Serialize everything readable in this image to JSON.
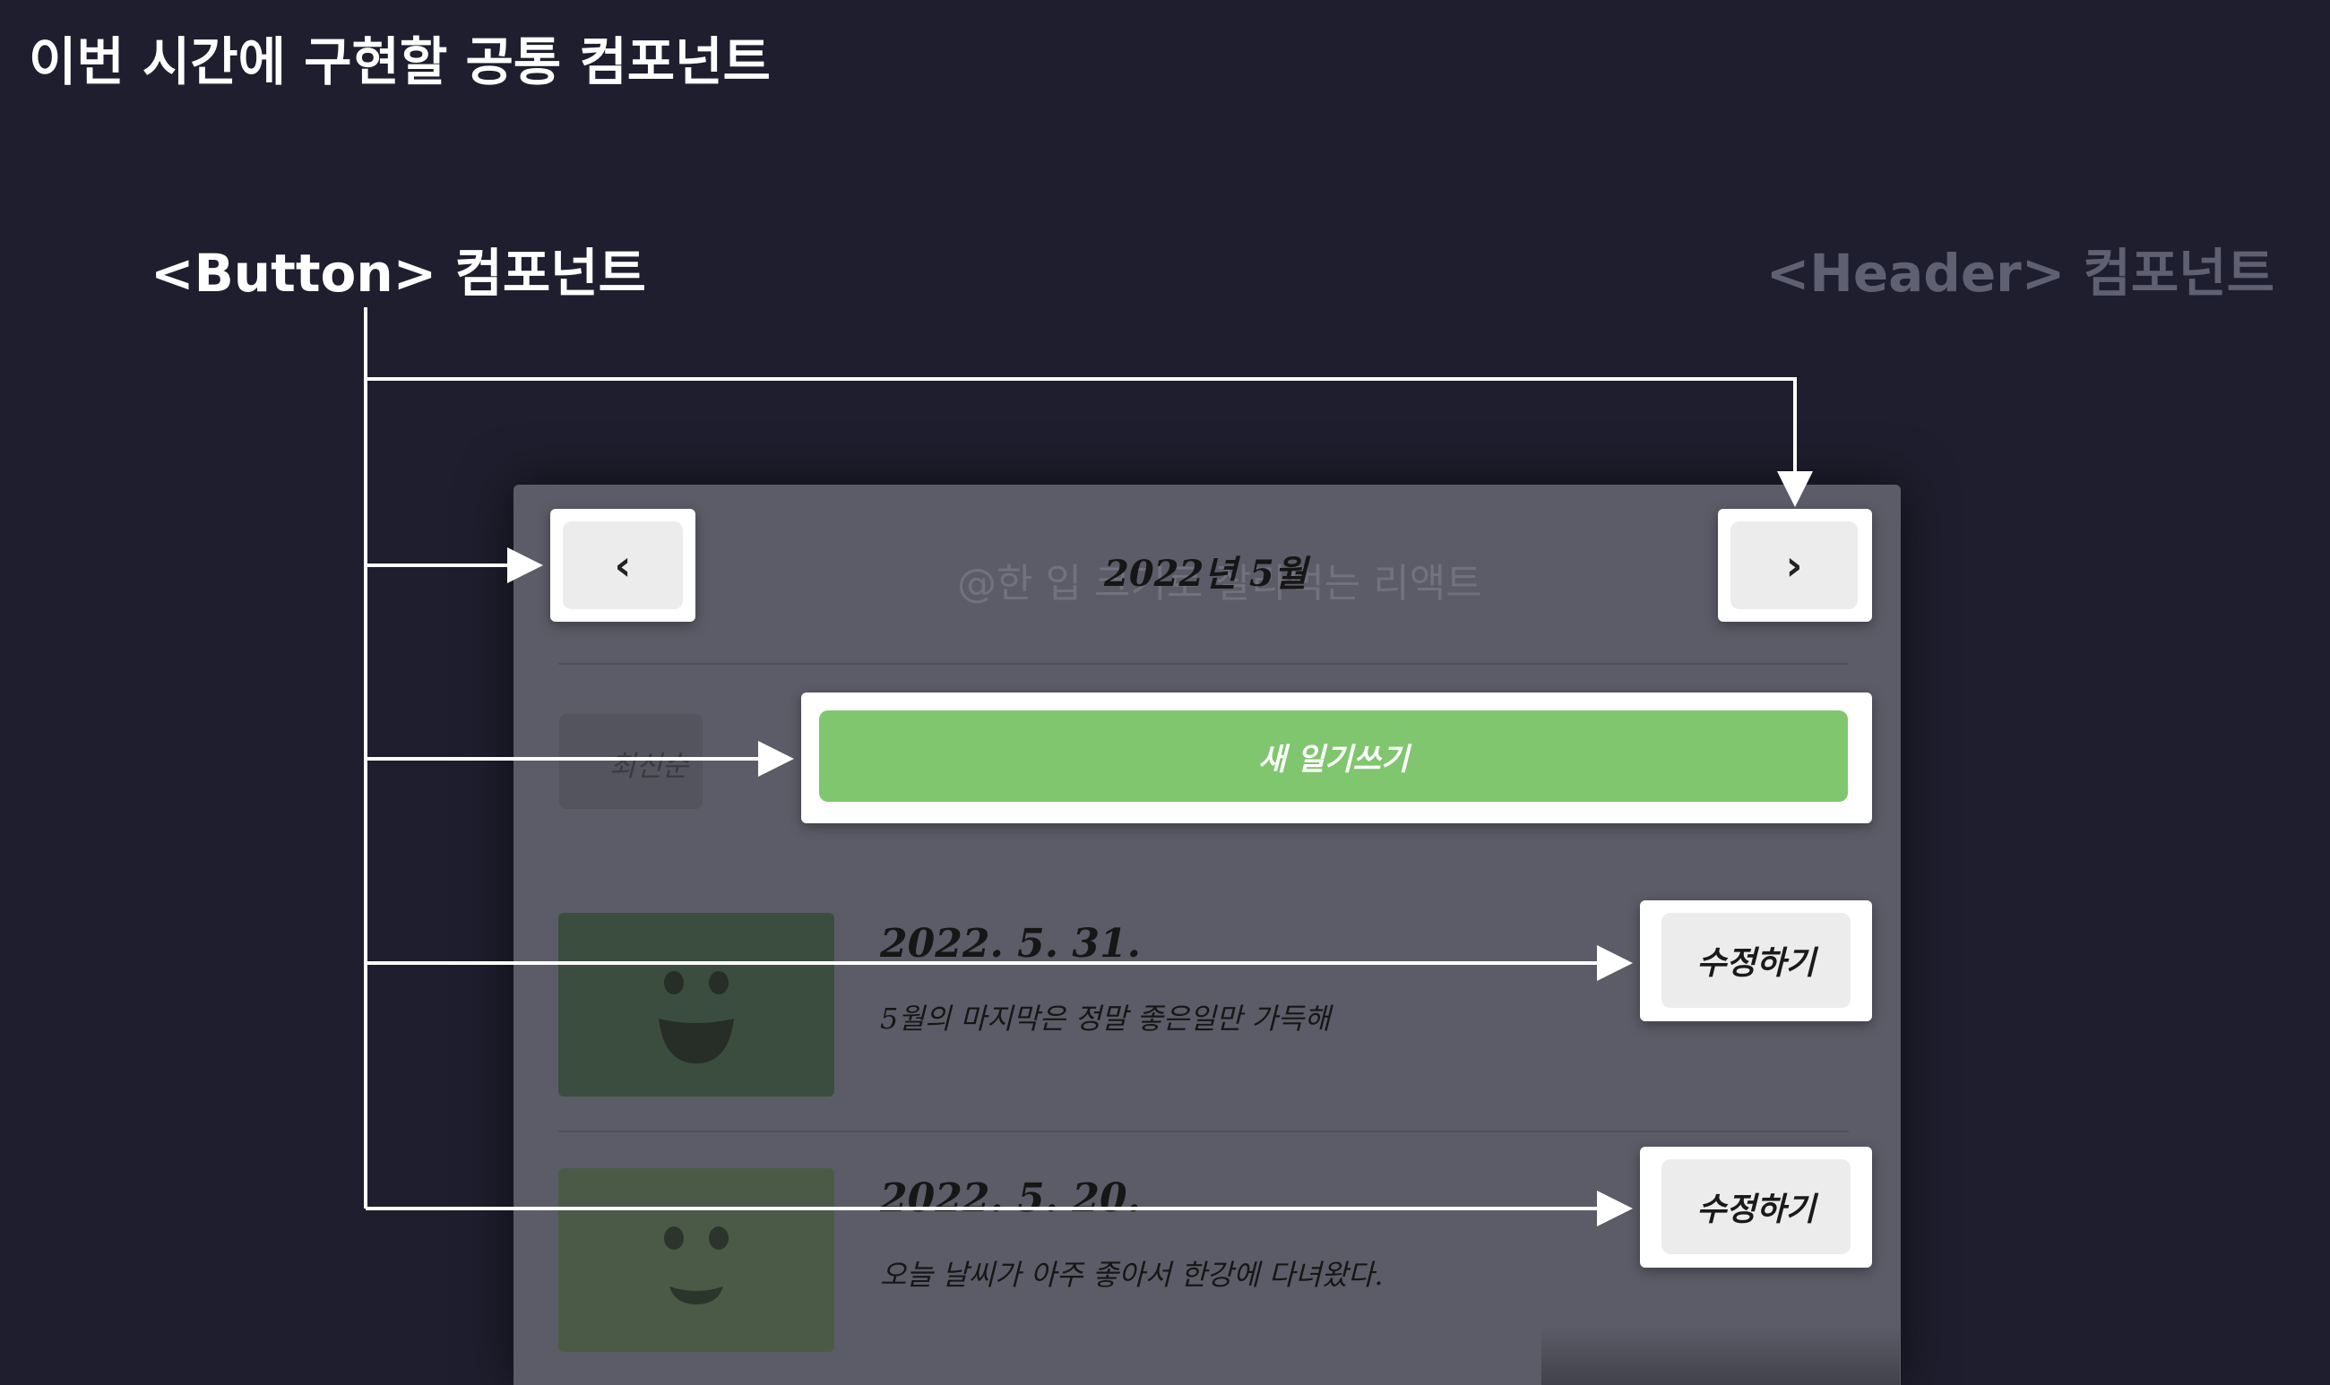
{
  "slide": {
    "title": "이번 시간에 구현할 공통 컴포넌트",
    "button_label": "<Button> 컴포넌트",
    "header_label": "<Header> 컴포넌트",
    "watermark": "@한 입 크기로 잘라먹는 리액트"
  },
  "app": {
    "header": {
      "title": "2022년 5월",
      "left_button": "‹",
      "right_button": "›"
    },
    "menu": {
      "sort_label": "최신순",
      "new_button": "새 일기쓰기"
    },
    "entries": [
      {
        "date": "2022. 5. 31.",
        "content": "5월의 마지막은 정말 좋은일만 가득해",
        "edit_label": "수정하기",
        "image": "smile-face-icon"
      },
      {
        "date": "2022. 5. 20.",
        "content": "오늘 날씨가 아주 좋아서 한강에 다녀왔다.",
        "edit_label": "수정하기",
        "image": "smile-face-icon"
      }
    ]
  },
  "colors": {
    "background": "#1e1e2e",
    "panel": "#5c5c68",
    "accent_green": "#80c66e",
    "emotion_green_1": "#3b4d3f",
    "emotion_green_2": "#4b5a47",
    "annotation_line": "#ffffff",
    "muted_label": "#5f6072"
  }
}
